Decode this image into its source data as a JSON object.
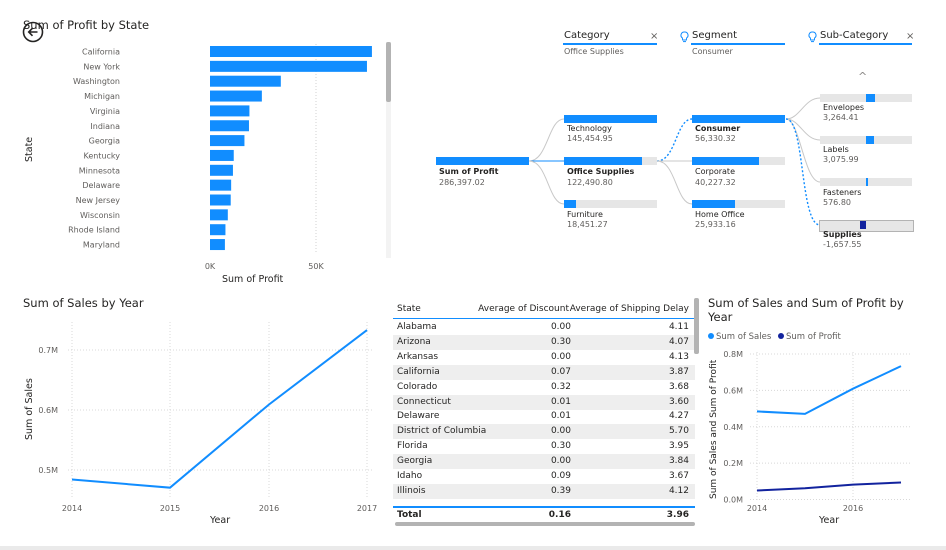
{
  "profit_by_state": {
    "title": "Sum of Profit by State",
    "ylabel": "State",
    "xlabel": "Sum of Profit",
    "ticks": [
      "0K",
      "50K"
    ]
  },
  "slicers": [
    {
      "label": "Category",
      "value": "Office Supplies",
      "clear": "×",
      "icon": "none"
    },
    {
      "label": "Segment",
      "value": "Consumer",
      "clear": "",
      "icon": "lightbulb-icon"
    },
    {
      "label": "Sub-Category",
      "value": "",
      "clear": "×",
      "icon": "lightbulb-icon"
    }
  ],
  "decomp": {
    "root": {
      "label": "Sum of Profit",
      "value": "286,397.02"
    },
    "category": [
      {
        "label": "Technology",
        "value": "145,454.95"
      },
      {
        "label": "Office Supplies",
        "value": "122,490.80"
      },
      {
        "label": "Furniture",
        "value": "18,451.27"
      }
    ],
    "segment": [
      {
        "label": "Consumer",
        "value": "56,330.32"
      },
      {
        "label": "Corporate",
        "value": "40,227.32"
      },
      {
        "label": "Home Office",
        "value": "25,933.16"
      }
    ],
    "subcategory": [
      {
        "label": "Envelopes",
        "value": "3,264.41"
      },
      {
        "label": "Labels",
        "value": "3,075.99"
      },
      {
        "label": "Fasteners",
        "value": "576.80"
      },
      {
        "label": "Supplies",
        "value": "-1,657.55"
      }
    ],
    "scroll_up": "^"
  },
  "sales_by_year": {
    "title": "Sum of Sales by Year",
    "xlabel": "Year",
    "ylabel": "Sum of Sales"
  },
  "table": {
    "headers": [
      "State",
      "Average of Discount",
      "Average of Shipping Delay"
    ],
    "rows": [
      [
        "Alabama",
        "0.00",
        "4.11"
      ],
      [
        "Arizona",
        "0.30",
        "4.07"
      ],
      [
        "Arkansas",
        "0.00",
        "4.13"
      ],
      [
        "California",
        "0.07",
        "3.87"
      ],
      [
        "Colorado",
        "0.32",
        "3.68"
      ],
      [
        "Connecticut",
        "0.01",
        "3.60"
      ],
      [
        "Delaware",
        "0.01",
        "4.27"
      ],
      [
        "District of Columbia",
        "0.00",
        "5.70"
      ],
      [
        "Florida",
        "0.30",
        "3.95"
      ],
      [
        "Georgia",
        "0.00",
        "3.84"
      ],
      [
        "Idaho",
        "0.09",
        "3.67"
      ],
      [
        "Illinois",
        "0.39",
        "4.12"
      ]
    ],
    "total": [
      "Total",
      "0.16",
      "3.96"
    ]
  },
  "sales_profit": {
    "title_line1": "Sum of Sales and Sum of Profit by",
    "title_line2": "Year",
    "legend": [
      "Sum of Sales",
      "Sum of Profit"
    ],
    "xlabel": "Year",
    "ylabel": "Sum of Sales and Sum of Profit"
  },
  "colors": {
    "primary": "#118dff",
    "secondary": "#12239e",
    "bg": "#ffffff"
  },
  "chart_data": [
    {
      "type": "bar",
      "title": "Sum of Profit by State",
      "xlabel": "Sum of Profit",
      "ylabel": "State",
      "orientation": "horizontal",
      "categories": [
        "California",
        "New York",
        "Washington",
        "Michigan",
        "Virginia",
        "Indiana",
        "Georgia",
        "Kentucky",
        "Minnesota",
        "Delaware",
        "New Jersey",
        "Wisconsin",
        "Rhode Island",
        "Maryland"
      ],
      "values": [
        76381,
        74039,
        33403,
        24463,
        18598,
        18383,
        16250,
        11200,
        10823,
        9977,
        9773,
        8402,
        7286,
        7031
      ],
      "xlim": [
        0,
        85000
      ],
      "x_ticks": [
        0,
        50000
      ],
      "grid": true
    },
    {
      "type": "line",
      "title": "Sum of Sales by Year",
      "xlabel": "Year",
      "ylabel": "Sum of Sales",
      "x": [
        2014,
        2015,
        2016,
        2017
      ],
      "values": [
        484247,
        470533,
        609206,
        733215
      ],
      "y_ticks": [
        500000,
        600000,
        700000
      ],
      "y_tick_labels": [
        "0.5M",
        "0.6M",
        "0.7M"
      ],
      "x_tick_labels": [
        "2014",
        "2015",
        "2016",
        "2017"
      ],
      "ylim": [
        450000,
        740000
      ],
      "grid": true
    },
    {
      "type": "line",
      "title": "Sum of Sales and Sum of Profit by Year",
      "xlabel": "Year",
      "ylabel": "Sum of Sales and Sum of Profit",
      "x": [
        2014,
        2015,
        2016,
        2017
      ],
      "series": [
        {
          "name": "Sum of Sales",
          "values": [
            484247,
            470533,
            609206,
            733215
          ]
        },
        {
          "name": "Sum of Profit",
          "values": [
            49544,
            61619,
            81795,
            93439
          ]
        }
      ],
      "y_ticks": [
        0,
        200000,
        400000,
        600000,
        800000
      ],
      "y_tick_labels": [
        "0.0M",
        "0.2M",
        "0.4M",
        "0.6M",
        "0.8M"
      ],
      "x_tick_labels": [
        "2014",
        "2016"
      ],
      "ylim": [
        0,
        800000
      ],
      "legend": "top-left",
      "grid": true
    }
  ]
}
